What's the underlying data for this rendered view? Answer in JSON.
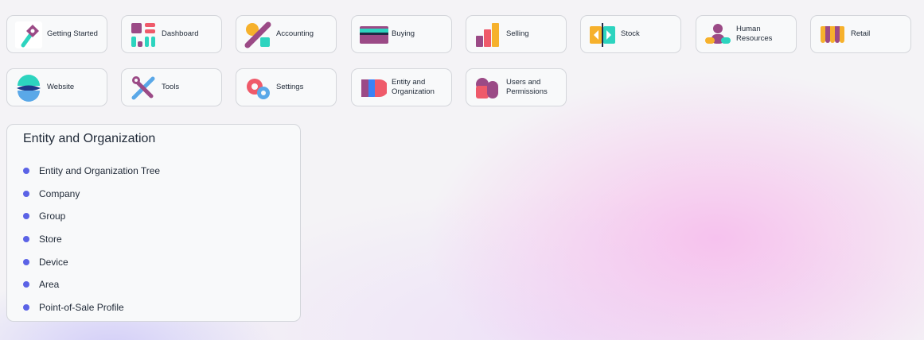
{
  "modules_row1": [
    {
      "name": "getting-started",
      "label": "Getting Started",
      "icon": "key-icon"
    },
    {
      "name": "dashboard",
      "label": "Dashboard",
      "icon": "dashboard-icon"
    },
    {
      "name": "accounting",
      "label": "Accounting",
      "icon": "percent-icon"
    },
    {
      "name": "buying",
      "label": "Buying",
      "icon": "card-icon"
    },
    {
      "name": "selling",
      "label": "Selling",
      "icon": "bar-chart-icon"
    },
    {
      "name": "stock",
      "label": "Stock",
      "icon": "stock-arrows-icon"
    },
    {
      "name": "human-resources",
      "label": "Human Resources",
      "icon": "people-icon"
    },
    {
      "name": "retail",
      "label": "Retail",
      "icon": "storefront-icon"
    }
  ],
  "modules_row2": [
    {
      "name": "website",
      "label": "Website",
      "icon": "globe-icon"
    },
    {
      "name": "tools",
      "label": "Tools",
      "icon": "tools-icon"
    },
    {
      "name": "settings",
      "label": "Settings",
      "icon": "gears-icon"
    },
    {
      "name": "entity-and-organization",
      "label": "Entity and Organization",
      "icon": "org-layers-icon"
    },
    {
      "name": "users-and-permissions",
      "label": "Users and Permissions",
      "icon": "users-icon"
    }
  ],
  "panel": {
    "title": "Entity and Organization",
    "items": [
      "Entity and Organization Tree",
      "Company",
      "Group",
      "Store",
      "Device",
      "Area",
      "Point-of-Sale Profile"
    ]
  },
  "colors": {
    "bullet": "#5b63e6",
    "tile_bg": "#f8f9fa",
    "tile_border": "#d4d6db"
  }
}
